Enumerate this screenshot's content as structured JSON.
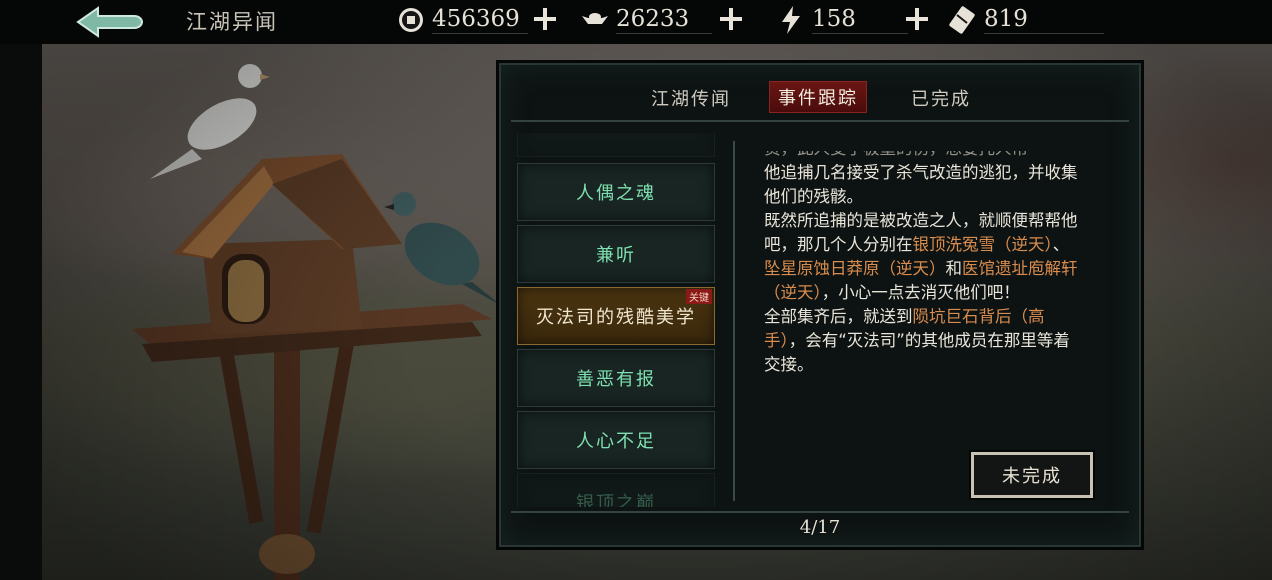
{
  "header": {
    "back_icon": "back-arrow-icon",
    "title": "江湖异闻",
    "resources": [
      {
        "id": "coins",
        "icon": "copper-coin-icon",
        "value": "456369"
      },
      {
        "id": "ingot",
        "icon": "silver-ingot-icon",
        "value": "26233"
      },
      {
        "id": "energy",
        "icon": "lightning-icon",
        "value": "158"
      },
      {
        "id": "ticket",
        "icon": "ticket-icon",
        "value": "819"
      }
    ]
  },
  "tabs": [
    {
      "label": "江湖传闻",
      "active": false
    },
    {
      "label": "事件跟踪",
      "active": true
    },
    {
      "label": "已完成",
      "active": false
    }
  ],
  "event_list": [
    {
      "label": "",
      "state": "partial-top"
    },
    {
      "label": "人偶之魂",
      "state": "normal"
    },
    {
      "label": "兼听",
      "state": "normal"
    },
    {
      "label": "灭法司的残酷美学",
      "state": "selected",
      "badge": "关键"
    },
    {
      "label": "善恶有报",
      "state": "normal"
    },
    {
      "label": "人心不足",
      "state": "normal"
    },
    {
      "label": "银顶之巅",
      "state": "faded"
    }
  ],
  "description": {
    "line_partial": "责，此人受了极重的伤，想要托人帮",
    "line1": "他追捕几名接受了杀气改造的逃犯，并收集他们的残骸。",
    "line2_a": "既然所追捕的是被改造之人，就顺便帮帮他吧，那几个人分别在",
    "loc1": "银顶洗冤雪（逆天）",
    "sep1": "、",
    "loc2": "坠星原蚀日莽原（逆天）",
    "and": "和",
    "loc3": "医馆遗址庖解轩（逆天）",
    "line2_end": "，小心一点去消灭他们吧！",
    "line3_a": "全部集齐后，就送到",
    "loc4": "陨坑巨石背后（高手）",
    "line3_end": "，会有“灭法司”的其他成员在那里等着交接。"
  },
  "status_button": "未完成",
  "pager": "4/17",
  "colors": {
    "accent_green": "#7ee0b0",
    "highlight_orange": "#d98c4e",
    "tab_active_red": "#6a1614"
  }
}
